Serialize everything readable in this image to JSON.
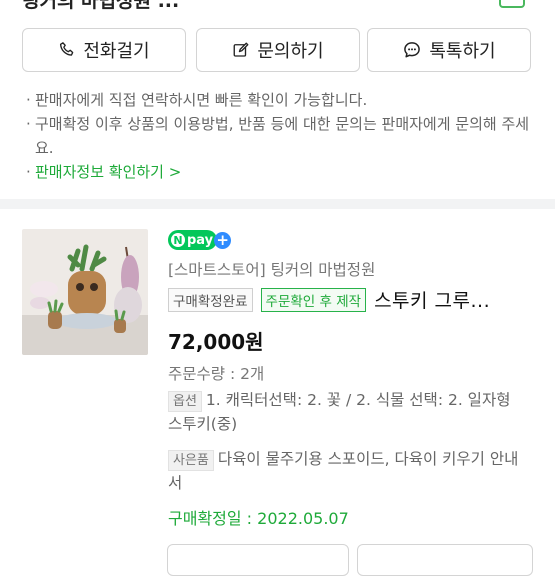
{
  "header": {
    "seller_title": "링커의 마법정원 ..."
  },
  "actions": {
    "call_label": "전화걸기",
    "inquiry_label": "문의하기",
    "talk_label": "톡톡하기"
  },
  "notes": [
    "판매자에게 직접 연락하시면 빠른 확인이 가능합니다.",
    "구매확정 이후 상품의 이용방법, 반품 등에 대한 문의는 판매자에게 문의해 주세요."
  ],
  "seller_info_link": "판매자정보 확인하기 >",
  "order": {
    "npay_text": "pay",
    "npay_n": "N",
    "npay_plus": "+",
    "store_name": "[스마트스토어] 팅커의 마법정원",
    "status_tag": "구매확정완료",
    "custom_tag": "주문확인 후 제작",
    "product_name": "스투키 그루...",
    "price": "72,000원",
    "quantity": "주문수량 : 2개",
    "option_chip": "옵션",
    "option_text": "1. 캐릭터선택: 2. 꽃 / 2. 식물 선택: 2. 일자형 스투키(중)",
    "gift_chip": "사은품",
    "gift_text": "다육이 물주기용 스포이드, 다육이 키우기 안내서",
    "confirm_date": "구매확정일 : 2022.05.07"
  },
  "colors": {
    "accent_green": "#1faa3a",
    "npay_green": "#03c75a",
    "npay_blue": "#2f8cff"
  },
  "icons": [
    "phone-icon",
    "pencil-square-icon",
    "chat-bubble-icon"
  ]
}
